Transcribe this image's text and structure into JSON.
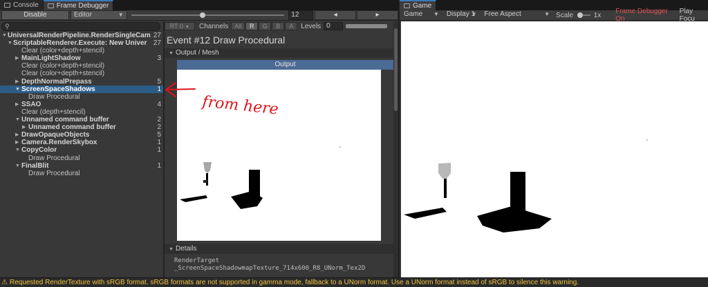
{
  "left_tabs": [
    {
      "label": "Console"
    },
    {
      "label": "Frame Debugger"
    }
  ],
  "fd_toolbar": {
    "disable_label": "Disable",
    "target_dropdown": "Editor",
    "event_index": "12",
    "event_slider_fraction": 0.45,
    "prev_icon": "◂",
    "next_icon": "▸"
  },
  "tree": {
    "search_icon": "⚲",
    "rows": [
      {
        "label": "UniversalRenderPipeline.RenderSingleCam",
        "count": "27"
      },
      {
        "label": "ScriptableRenderer.Execute: New Univer",
        "count": "27"
      },
      {
        "label": "Clear (color+depth+stencil)",
        "count": ""
      },
      {
        "label": "MainLightShadow",
        "count": "3"
      },
      {
        "label": "Clear (color+depth+stencil)",
        "count": ""
      },
      {
        "label": "Clear (color+depth+stencil)",
        "count": ""
      },
      {
        "label": "DepthNormalPrepass",
        "count": "5"
      },
      {
        "label": "ScreenSpaceShadows",
        "count": "1"
      },
      {
        "label": "Draw Procedural",
        "count": ""
      },
      {
        "label": "SSAO",
        "count": "4"
      },
      {
        "label": "Clear (depth+stencil)",
        "count": ""
      },
      {
        "label": "Unnamed command buffer",
        "count": "2"
      },
      {
        "label": "Unnamed command buffer",
        "count": "2"
      },
      {
        "label": "DrawOpaqueObjects",
        "count": "5"
      },
      {
        "label": "Camera.RenderSkybox",
        "count": "1"
      },
      {
        "label": "CopyColor",
        "count": "1"
      },
      {
        "label": "Draw Procedural",
        "count": ""
      },
      {
        "label": "FinalBlit",
        "count": "1"
      },
      {
        "label": "Draw Procedural",
        "count": ""
      }
    ]
  },
  "event_toolbar": {
    "rt": "RT 0",
    "channels_label": "Channels",
    "channel_buttons": [
      "All",
      "R",
      "G",
      "B",
      "A"
    ],
    "levels_label": "Levels",
    "levels_value": "0"
  },
  "event": {
    "title": "Event #12 Draw Procedural",
    "output_mesh_label": "Output / Mesh",
    "output_label": "Output",
    "details_label": "Details",
    "details_line1": "RenderTarget",
    "details_line2": "_ScreenSpaceShadowmapTexture_714x600_R8_UNorm_Tex2D"
  },
  "annotation": {
    "text": "from here",
    "color": "#e0131a"
  },
  "game": {
    "tab_label": "Game",
    "mode_dropdown": "Game",
    "display_dropdown": "Display 1",
    "aspect_dropdown": "Free Aspect",
    "scale_label": "Scale",
    "scale_value": "1x",
    "frame_debugger_on": "Frame Debugger On",
    "play_focused": "Play Focu"
  },
  "status": {
    "message": "Requested RenderTexture with sRGB format. sRGB formats are not supported in gamma mode, fallback to a UNorm format. Use a UNorm format instead of sRGB to silence this warning."
  },
  "colors": {
    "selection": "#2c5d87",
    "accent_tab": "#3a79bb",
    "warning": "#f3c642",
    "fd_on": "#e05454"
  }
}
